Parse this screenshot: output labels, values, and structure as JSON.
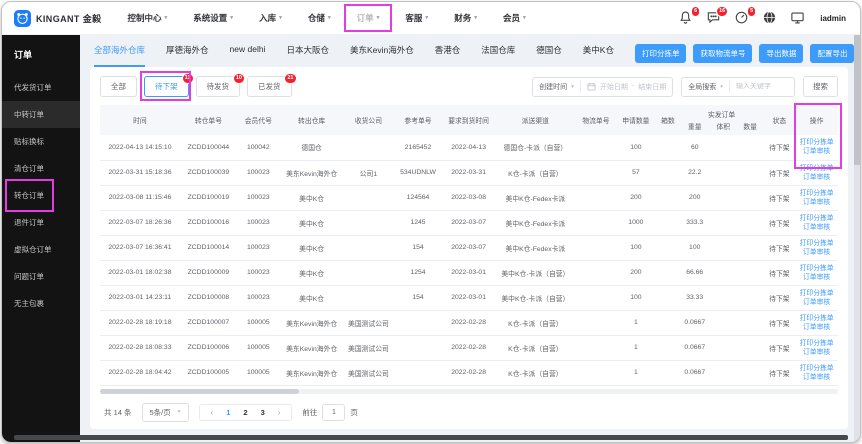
{
  "colors": {
    "accent": "#3d9bfc",
    "annotation": "#e23ce2",
    "badge": "#f5222d",
    "sidebar_bg": "#131313"
  },
  "topnav": {
    "brand": "KINGANT 金毅",
    "items": [
      {
        "name": "control-center",
        "label": "控制中心"
      },
      {
        "name": "system-settings",
        "label": "系统设置"
      },
      {
        "name": "inbound",
        "label": "入库"
      },
      {
        "name": "warehouse",
        "label": "仓储"
      },
      {
        "name": "orders",
        "label": "订单",
        "annotated": true,
        "muted": true
      },
      {
        "name": "customer-service",
        "label": "客服"
      },
      {
        "name": "finance",
        "label": "财务"
      },
      {
        "name": "member",
        "label": "会员"
      }
    ],
    "badges": {
      "bell": "6",
      "message": "16",
      "gauge": "5"
    },
    "username": "iadmin"
  },
  "sidebar": {
    "title": "订单",
    "items": [
      {
        "name": "dropship-orders",
        "label": "代发货订单"
      },
      {
        "name": "transit-orders",
        "label": "中转订单",
        "active": true
      },
      {
        "name": "relabel",
        "label": "贴标换标"
      },
      {
        "name": "clearance-orders",
        "label": "清仓订单"
      },
      {
        "name": "transfer-orders",
        "label": "转仓订单",
        "annotated": true
      },
      {
        "name": "return-orders",
        "label": "退件订单"
      },
      {
        "name": "virtual-warehouse-orders",
        "label": "虚拟仓订单"
      },
      {
        "name": "problem-orders",
        "label": "问题订单"
      },
      {
        "name": "unclaimed-packages",
        "label": "无主包裹"
      }
    ]
  },
  "warehouse_tabs": [
    {
      "name": "all-overseas",
      "label": "全部海外仓库",
      "active": true
    },
    {
      "name": "houde",
      "label": "厚德海外仓"
    },
    {
      "name": "new-delhi",
      "label": "new delhi"
    },
    {
      "name": "japan-osaka",
      "label": "日本大阪仓"
    },
    {
      "name": "us-east-kevin",
      "label": "美东Kevin海外仓"
    },
    {
      "name": "hongkong",
      "label": "香港仓"
    },
    {
      "name": "france",
      "label": "法国仓库"
    },
    {
      "name": "germany",
      "label": "德国仓"
    },
    {
      "name": "us-mid-k",
      "label": "美中K仓"
    }
  ],
  "header_actions": [
    {
      "name": "print-picking-list",
      "label": "打印分拣单"
    },
    {
      "name": "get-tracking-number",
      "label": "获取物流单号"
    },
    {
      "name": "export-data",
      "label": "导出数据"
    },
    {
      "name": "export-config",
      "label": "配置导出"
    }
  ],
  "filters": {
    "chips": [
      {
        "name": "all",
        "label": "全部"
      },
      {
        "name": "to-unshelve",
        "label": "待下架",
        "count": "11",
        "active": true,
        "annotated": true
      },
      {
        "name": "to-ship",
        "label": "待发货",
        "count": "10"
      },
      {
        "name": "shipped",
        "label": "已发货",
        "count": "21"
      }
    ],
    "time_field_select": "创建时间",
    "date_start_placeholder": "开始日期",
    "date_separator": "-",
    "date_end_placeholder": "结束日期",
    "scope_select": "全局搜索",
    "keyword_placeholder": "输入关键字",
    "search_button": "搜索"
  },
  "table": {
    "headers": [
      "时间",
      "转仓单号",
      "会员代号",
      "转出仓库",
      "收货公司",
      "参考单号",
      "要求到货时间",
      "派送渠道",
      "物流单号",
      "申请数量",
      "箱数",
      "状态",
      "操作"
    ],
    "group_header": {
      "label": "实发订单",
      "children": [
        "重量",
        "体积",
        "数量"
      ]
    },
    "row_actions": [
      {
        "name": "print-pick-link",
        "label": "打印分拣单"
      },
      {
        "name": "order-review-link",
        "label": "订单审核"
      }
    ],
    "rows": [
      {
        "time": "2022-04-13 14:15:10",
        "order_no": "ZCDD100044",
        "member": "100042",
        "warehouse": "德国仓",
        "company": "",
        "ref": "2165452",
        "required_time": "2022-04-13",
        "channel": "德国仓-卡派（自营）",
        "tracking": "",
        "qty": "100",
        "boxes": "",
        "weight": "60",
        "volume": "",
        "count": "",
        "status": "待下架"
      },
      {
        "time": "2022-03-31 15:18:36",
        "order_no": "ZCDD100039",
        "member": "100023",
        "warehouse": "美东Kevin海外仓",
        "company": "公司1",
        "ref": "534UDNLW",
        "required_time": "2022-03-31",
        "channel": "K仓-卡派（自营）",
        "tracking": "",
        "qty": "57",
        "boxes": "",
        "weight": "22.2",
        "volume": "",
        "count": "",
        "status": "待下架"
      },
      {
        "time": "2022-03-08 11:15:46",
        "order_no": "ZCDD100019",
        "member": "100023",
        "warehouse": "美中K仓",
        "company": "",
        "ref": "124564",
        "required_time": "2022-03-08",
        "channel": "美中K仓-Fedex卡派",
        "tracking": "",
        "qty": "200",
        "boxes": "",
        "weight": "200",
        "volume": "",
        "count": "",
        "status": "待下架"
      },
      {
        "time": "2022-03-07 18:26:36",
        "order_no": "ZCDD100016",
        "member": "100023",
        "warehouse": "美中K仓",
        "company": "",
        "ref": "1245",
        "required_time": "2022-03-07",
        "channel": "美中K仓-Fedex卡派",
        "tracking": "",
        "qty": "1000",
        "boxes": "",
        "weight": "333.3",
        "volume": "",
        "count": "",
        "status": "待下架"
      },
      {
        "time": "2022-03-07 16:36:41",
        "order_no": "ZCDD100014",
        "member": "100023",
        "warehouse": "美中K仓",
        "company": "",
        "ref": "154",
        "required_time": "2022-03-07",
        "channel": "美中K仓-Fedex卡派",
        "tracking": "",
        "qty": "100",
        "boxes": "",
        "weight": "100",
        "volume": "",
        "count": "",
        "status": "待下架"
      },
      {
        "time": "2022-03-01 18:02:38",
        "order_no": "ZCDD100009",
        "member": "100023",
        "warehouse": "美中K仓",
        "company": "",
        "ref": "1254",
        "required_time": "2022-03-01",
        "channel": "美中K仓-卡派（自营）",
        "tracking": "",
        "qty": "200",
        "boxes": "",
        "weight": "66.66",
        "volume": "",
        "count": "",
        "status": "待下架"
      },
      {
        "time": "2022-03-01 14:23:11",
        "order_no": "ZCDD100008",
        "member": "100023",
        "warehouse": "美中K仓",
        "company": "",
        "ref": "154",
        "required_time": "2022-03-01",
        "channel": "美中K仓-卡派（自营）",
        "tracking": "",
        "qty": "100",
        "boxes": "",
        "weight": "33.33",
        "volume": "",
        "count": "",
        "status": "待下架"
      },
      {
        "time": "2022-02-28 18:19:18",
        "order_no": "ZCDD100007",
        "member": "100005",
        "warehouse": "美东Kevin海外仓",
        "company": "美国测试公司",
        "ref": "",
        "required_time": "2022-02-28",
        "channel": "K仓-卡派（自营）",
        "tracking": "",
        "qty": "1",
        "boxes": "",
        "weight": "0.0667",
        "volume": "",
        "count": "",
        "status": "待下架"
      },
      {
        "time": "2022-02-28 18:08:33",
        "order_no": "ZCDD100006",
        "member": "100005",
        "warehouse": "美东Kevin海外仓",
        "company": "美国测试公司",
        "ref": "",
        "required_time": "2022-02-28",
        "channel": "K仓-卡派（自营）",
        "tracking": "",
        "qty": "1",
        "boxes": "",
        "weight": "0.0667",
        "volume": "",
        "count": "",
        "status": "待下架"
      },
      {
        "time": "2022-02-28 18:04:42",
        "order_no": "ZCDD100005",
        "member": "100005",
        "warehouse": "美东Kevin海外仓",
        "company": "美国测试公司",
        "ref": "",
        "required_time": "2022-02-28",
        "channel": "K仓-卡派（自营）",
        "tracking": "",
        "qty": "1",
        "boxes": "",
        "weight": "0.0667",
        "volume": "",
        "count": "",
        "status": "待下架"
      }
    ]
  },
  "pagination": {
    "total": "共 14 条",
    "page_size": "5条/页",
    "pages": [
      "1",
      "2",
      "3"
    ],
    "active_page": "1",
    "goto_label": "前往",
    "goto_value": "1",
    "goto_suffix": "页"
  }
}
